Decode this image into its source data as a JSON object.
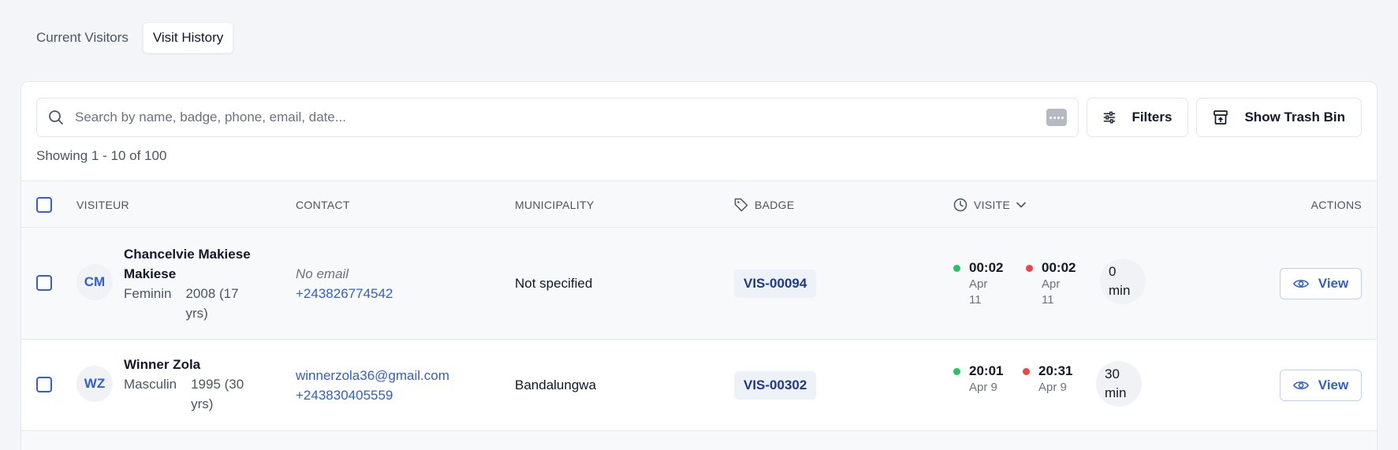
{
  "tabs": [
    {
      "label": "Current Visitors",
      "active": false
    },
    {
      "label": "Visit History",
      "active": true
    }
  ],
  "search": {
    "placeholder": "Search by name, badge, phone, email, date...",
    "value": ""
  },
  "toolbar": {
    "filters_label": "Filters",
    "trash_label": "Show Trash Bin"
  },
  "showing_text": "Showing 1 - 10 of 100",
  "table": {
    "headers": {
      "visitor": "VISITEUR",
      "contact": "CONTACT",
      "municipality": "MUNICIPALITY",
      "badge": "BADGE",
      "visit": "VISITE",
      "actions": "ACTIONS"
    },
    "rows": [
      {
        "initials": "CM",
        "name_line1": "Chancelvie Makiese",
        "name_line2": "Makiese",
        "gender": "Feminin",
        "birth_line1": "2008 (17",
        "birth_line2": "yrs)",
        "email": "No email",
        "email_missing": true,
        "phone": "+243826774542",
        "municipality": "Not specified",
        "badge": "VIS-00094",
        "check_in_time": "00:02",
        "check_in_date_line1": "Apr",
        "check_in_date_line2": "11",
        "check_out_time": "00:02",
        "check_out_date_line1": "Apr",
        "check_out_date_line2": "11",
        "duration_line1": "0",
        "duration_line2": "min",
        "action_label": "View"
      },
      {
        "initials": "WZ",
        "name_line1": "Winner Zola",
        "name_line2": "",
        "gender": "Masculin",
        "birth_line1": "1995 (30",
        "birth_line2": "yrs)",
        "email": "winnerzola36@gmail.com",
        "email_missing": false,
        "phone": "+243830405559",
        "municipality": "Bandalungwa",
        "badge": "VIS-00302",
        "check_in_time": "20:01",
        "check_in_date_line1": "Apr 9",
        "check_in_date_line2": "",
        "check_out_time": "20:31",
        "check_out_date_line1": "Apr 9",
        "check_out_date_line2": "",
        "duration_line1": "30",
        "duration_line2": "min",
        "action_label": "View"
      }
    ]
  },
  "colors": {
    "accent": "#2f5fd0",
    "check_in": "#22c55e",
    "check_out": "#ef4444",
    "page_bg": "#f3f5f8"
  },
  "icons": [
    "search-icon",
    "keyboard-icon",
    "sliders-icon",
    "archive-icon",
    "tag-icon",
    "clock-icon",
    "chevron-down-icon",
    "eye-icon"
  ]
}
